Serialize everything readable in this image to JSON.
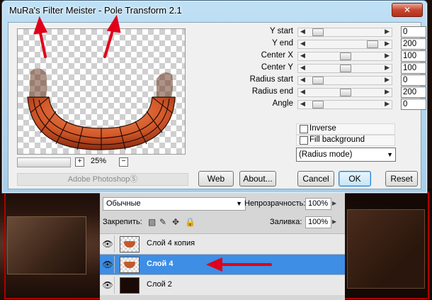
{
  "window": {
    "title": "MuRa's Filter Meister - Pole Transform 2.1",
    "close_icon": "close-icon"
  },
  "preview": {
    "zoom_value": "25%",
    "zoom_in": "+",
    "zoom_out": "−",
    "brand": "Adobe PhotoshopⓈ"
  },
  "params": [
    {
      "label": "Y start",
      "value": "0",
      "level": 0.09
    },
    {
      "label": "Y end",
      "value": "200",
      "level": 0.9
    },
    {
      "label": "Center X",
      "value": "100",
      "level": 0.5
    },
    {
      "label": "Center Y",
      "value": "100",
      "level": 0.5
    },
    {
      "label": "Radius start",
      "value": "0",
      "level": 0.09
    },
    {
      "label": "Radius end",
      "value": "200",
      "level": 0.5
    },
    {
      "label": "Angle",
      "value": "0",
      "level": 0.09
    }
  ],
  "checks": {
    "inverse": "Inverse",
    "fill_background": "Fill background"
  },
  "mode_select": "(Radius mode)",
  "buttons": {
    "web": "Web",
    "about": "About...",
    "cancel": "Cancel",
    "ok": "OK",
    "reset": "Reset"
  },
  "layers": {
    "blend_mode": "Обычные",
    "opacity_label": "Непрозрачность:",
    "opacity_value": "100%",
    "lock_label": "Закрепить:",
    "fill_label": "Заливка:",
    "fill_value": "100%",
    "items": [
      {
        "name": "Слой 4 копия"
      },
      {
        "name": "Слой 4"
      },
      {
        "name": "Слой 2"
      }
    ]
  },
  "colors": {
    "accent_red": "#e0001a",
    "selection_blue": "#3d8ee4"
  }
}
